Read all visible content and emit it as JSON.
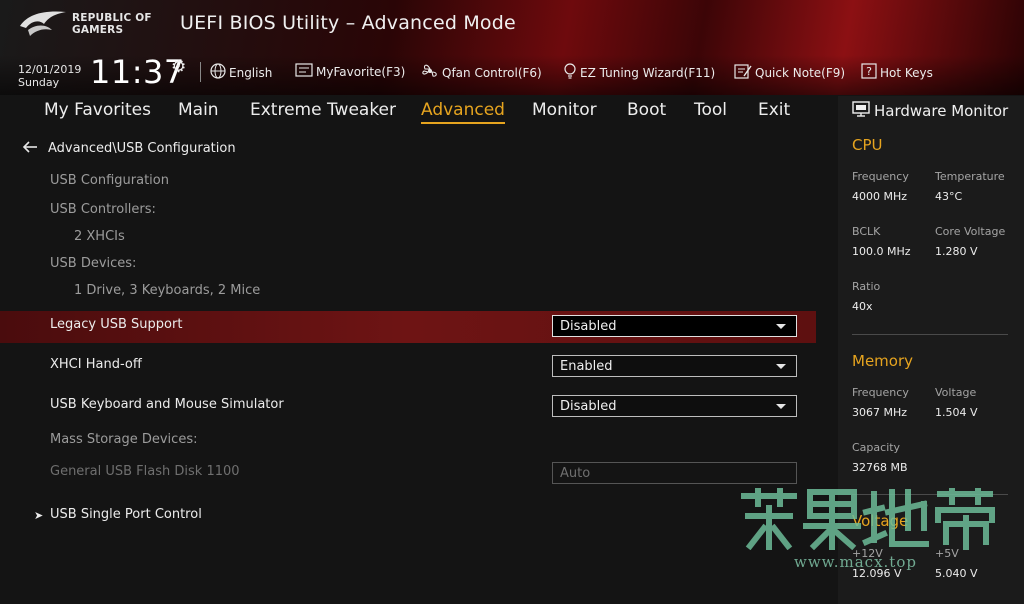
{
  "header": {
    "logo_text": "REPUBLIC OF GAMERS",
    "app_title": "UEFI BIOS Utility – Advanced Mode",
    "date": "12/01/2019",
    "weekday": "Sunday",
    "time": "11:37",
    "toolbar": [
      {
        "label": "English",
        "icon": "globe-icon"
      },
      {
        "label": "MyFavorite(F3)",
        "icon": "favorite-icon"
      },
      {
        "label": "Qfan Control(F6)",
        "icon": "fan-icon"
      },
      {
        "label": "EZ Tuning Wizard(F11)",
        "icon": "bulb-icon"
      },
      {
        "label": "Quick Note(F9)",
        "icon": "note-icon"
      },
      {
        "label": "Hot Keys",
        "icon": "question-icon"
      }
    ]
  },
  "nav": {
    "tabs": [
      "My Favorites",
      "Main",
      "Extreme Tweaker",
      "Advanced",
      "Monitor",
      "Boot",
      "Tool",
      "Exit"
    ],
    "active": "Advanced"
  },
  "main": {
    "breadcrumb": "Advanced\\USB Configuration",
    "section_title": "USB Configuration",
    "controllers_label": "USB Controllers:",
    "controllers_value": "2 XHCIs",
    "devices_label": "USB Devices:",
    "devices_value": "1 Drive, 3 Keyboards, 2 Mice",
    "settings": [
      {
        "label": "Legacy USB Support",
        "value": "Disabled"
      },
      {
        "label": "XHCI Hand-off",
        "value": "Enabled"
      },
      {
        "label": "USB Keyboard and Mouse Simulator",
        "value": "Disabled"
      }
    ],
    "mass_storage_label": "Mass Storage Devices:",
    "flash_disk_label": "General USB Flash Disk 1100",
    "flash_disk_value": "Auto",
    "submenu": "USB Single Port Control"
  },
  "hardware_monitor": {
    "title": "Hardware Monitor",
    "cpu": {
      "title": "CPU",
      "frequency_label": "Frequency",
      "frequency": "4000 MHz",
      "temperature_label": "Temperature",
      "temperature": "43°C",
      "bclk_label": "BCLK",
      "bclk": "100.0 MHz",
      "core_voltage_label": "Core Voltage",
      "core_voltage": "1.280 V",
      "ratio_label": "Ratio",
      "ratio": "40x"
    },
    "memory": {
      "title": "Memory",
      "frequency_label": "Frequency",
      "frequency": "3067 MHz",
      "voltage_label": "Voltage",
      "voltage": "1.504 V",
      "capacity_label": "Capacity",
      "capacity": "32768 MB"
    },
    "voltage": {
      "title": "Voltage",
      "v12_label": "+12V",
      "v12": "12.096 V",
      "v5_label": "+5V",
      "v5": "5.040 V"
    }
  },
  "watermark": {
    "url": "www.macx.top"
  },
  "colors": {
    "accent": "#e6a41f",
    "highlight": "#6e1414",
    "header_red": "#8c1013"
  }
}
